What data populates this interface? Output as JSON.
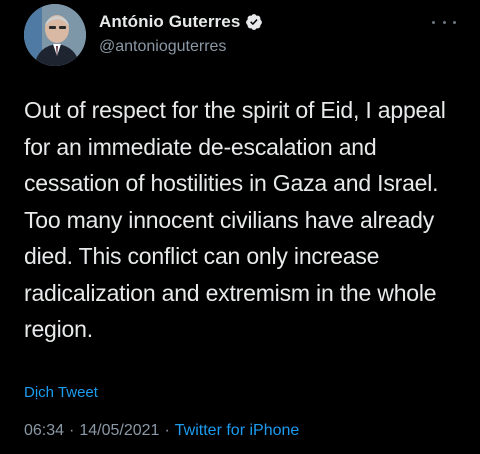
{
  "author": {
    "display_name": "António Guterres",
    "handle": "@antonioguterres"
  },
  "tweet": {
    "text": "Out of respect for the spirit of Eid, I appeal for an immediate de-escalation and cessation of hostilities in Gaza and Israel. Too many innocent civilians have already died. This conflict can only increase radicalization and extremism in the whole region.",
    "translate_label": "Dịch Tweet",
    "time": "06:34",
    "date": "14/05/2021",
    "separator": "·",
    "source": "Twitter for iPhone"
  },
  "icons": {
    "verified": "verified-badge-icon",
    "more": "more-options-icon"
  },
  "colors": {
    "background": "#000000",
    "text": "#e7e9ea",
    "secondary": "#8b98a5",
    "accent": "#1d9bf0"
  }
}
